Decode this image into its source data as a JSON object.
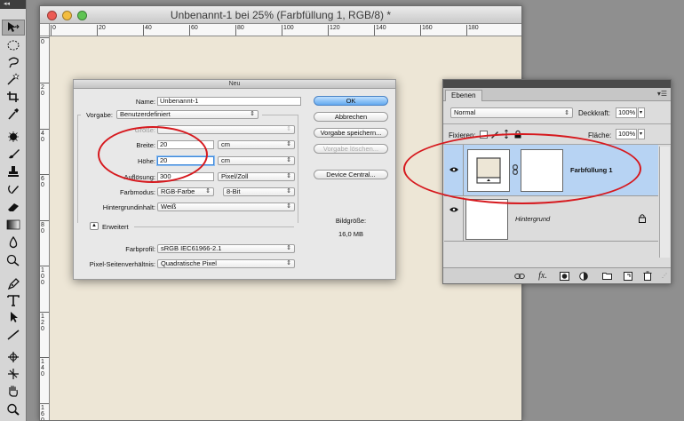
{
  "document": {
    "title": "Unbenannt-1 bei 25% (Farbfüllung 1, RGB/8) *",
    "hruler_labels": [
      "0",
      "20",
      "40",
      "60",
      "80",
      "100",
      "120",
      "140",
      "160",
      "180"
    ],
    "vruler_labels": [
      "0",
      "2 0",
      "4 0",
      "6 0",
      "8 0",
      "1 0 0",
      "1 2 0",
      "1 4 0",
      "1 6 0"
    ],
    "canvas_color": "#ede6d6"
  },
  "toolbox": {
    "grip": "◂◂",
    "tools": [
      "move-icon",
      "ellipse-marquee-icon",
      "lasso-icon",
      "magic-wand-icon",
      "crop-icon",
      "eyedropper-icon",
      "healing-brush-icon",
      "brush-icon",
      "clone-stamp-icon",
      "history-brush-icon",
      "eraser-icon",
      "gradient-icon",
      "blur-icon",
      "dodge-icon",
      "pen-icon",
      "type-icon",
      "path-select-icon",
      "line-icon",
      "3d-rotate-icon",
      "3d-camera-icon",
      "hand-icon",
      "zoom-icon"
    ]
  },
  "dialog": {
    "title": "Neu",
    "name_label": "Name:",
    "name_value": "Unbenannt-1",
    "preset_label": "Vorgabe:",
    "preset_value": "Benutzerdefiniert",
    "size_label": "Größe:",
    "width_label": "Breite:",
    "width_value": "20",
    "width_unit": "cm",
    "height_label": "Höhe:",
    "height_value": "20",
    "height_unit": "cm",
    "resolution_label": "Auflösung:",
    "resolution_value": "300",
    "resolution_unit": "Pixel/Zoll",
    "color_mode_label": "Farbmodus:",
    "color_mode_value": "RGB-Farbe",
    "bit_depth_value": "8-Bit",
    "background_label": "Hintergrundinhalt:",
    "background_value": "Weiß",
    "advanced_label": "Erweitert",
    "profile_label": "Farbprofil:",
    "profile_value": "sRGB IEC61966-2.1",
    "pixel_aspect_label": "Pixel-Seitenverhältnis:",
    "pixel_aspect_value": "Quadratische Pixel",
    "ok_label": "OK",
    "cancel_label": "Abbrechen",
    "save_preset_label": "Vorgabe speichern...",
    "delete_preset_label": "Vorgabe löschen...",
    "device_central_label": "Device Central...",
    "image_size_label": "Bildgröße:",
    "image_size_value": "16,0 MB"
  },
  "layers_panel": {
    "tab_label": "Ebenen",
    "menu_icon": "▾☰",
    "blend_mode": "Normal",
    "opacity_label": "Deckkraft:",
    "opacity_value": "100%",
    "lock_label": "Fixieren:",
    "fill_label": "Fläche:",
    "fill_value": "100%",
    "layers": [
      {
        "name": "Farbfüllung 1",
        "selected": true
      },
      {
        "name": "Hintergrund",
        "selected": false
      }
    ],
    "footer_icons": [
      "link-icon",
      "fx-icon",
      "mask-icon",
      "adjustment-icon",
      "group-icon",
      "new-layer-icon",
      "trash-icon"
    ]
  },
  "colors": {
    "selected_row": "#b7d3f3",
    "annotation_red": "#d6191e",
    "ok_blue": "#62a8ee"
  }
}
